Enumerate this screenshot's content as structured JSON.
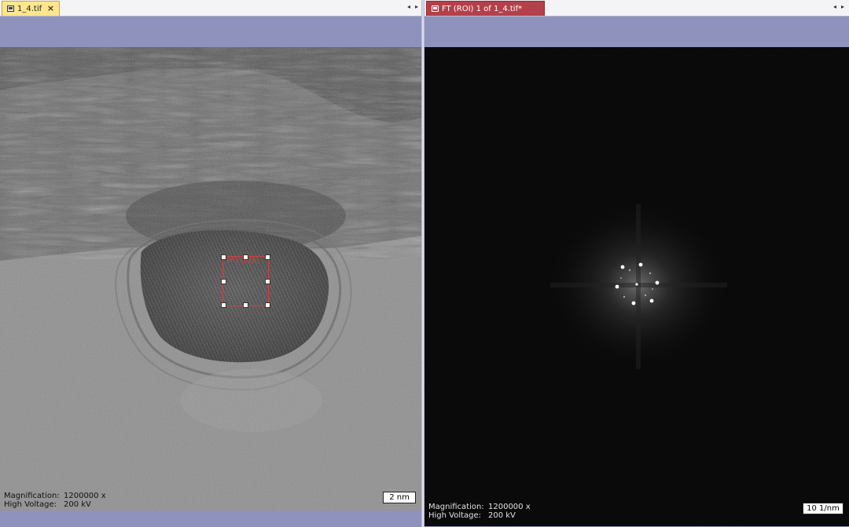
{
  "left_window": {
    "tab_title": "1_4.tif",
    "close_glyph": "×",
    "nav_prev": "◂",
    "nav_next": "▸",
    "roi_label": "FFT (ROI)",
    "info": {
      "magnification_label": "Magnification:",
      "magnification_value": "1200000 x",
      "voltage_label": "High Voltage:",
      "voltage_value": "200 kV"
    },
    "scale_bar": "2 nm"
  },
  "right_window": {
    "tab_title": "FT (ROI) 1 of 1_4.tif*",
    "close_glyph": "",
    "nav_prev": "◂",
    "nav_next": "▸",
    "info": {
      "magnification_label": "Magnification:",
      "magnification_value": "1200000 x",
      "voltage_label": "High Voltage:",
      "voltage_value": "200 kV"
    },
    "scale_bar": "10 1/nm"
  },
  "colors": {
    "tab_active": "#fde68c",
    "tab_fft": "#b3404a",
    "roi_outline": "#d04040",
    "pane_background": "#8f92bd"
  },
  "icons": [
    "image-window-icon",
    "close-icon",
    "scroll-left-icon",
    "scroll-right-icon"
  ]
}
